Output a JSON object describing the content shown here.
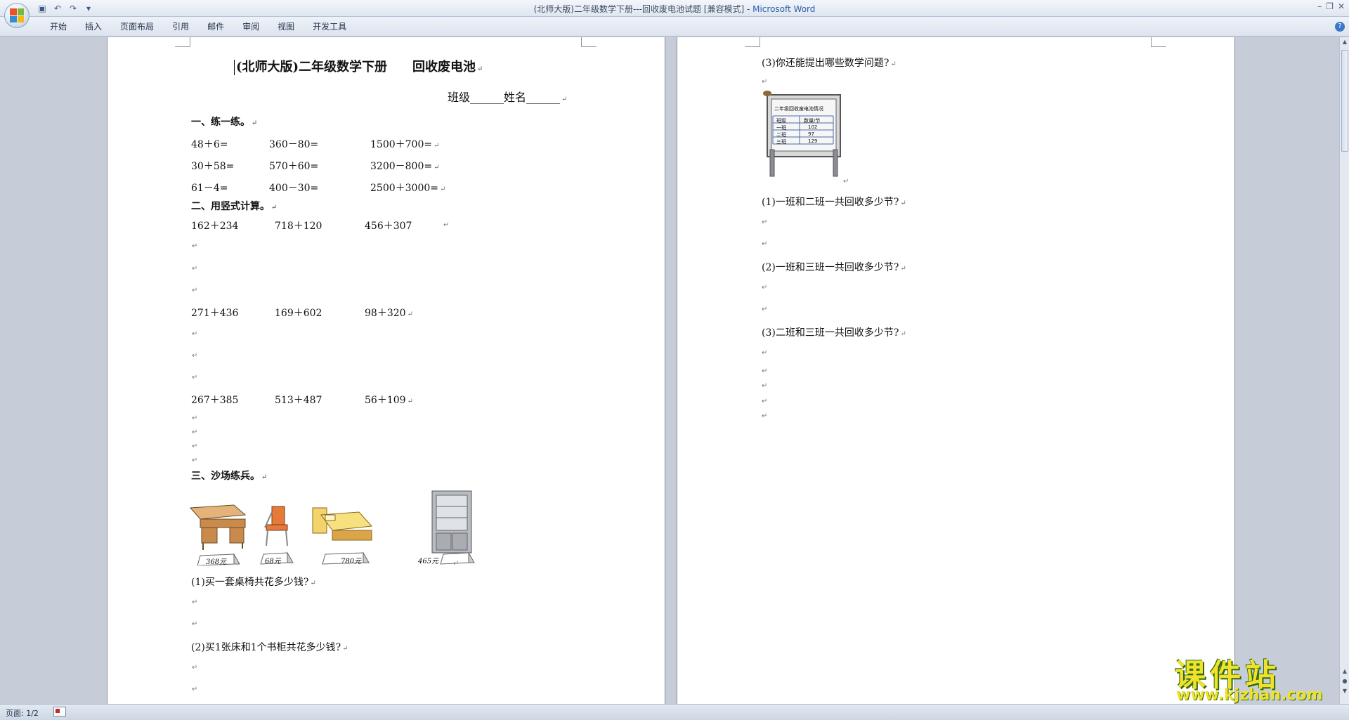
{
  "window": {
    "title_doc": "(北师大版)二年级数学下册---回收废电池试题 [兼容模式] - ",
    "title_app": "Microsoft Word"
  },
  "ribbon": {
    "tabs": [
      "开始",
      "插入",
      "页面布局",
      "引用",
      "邮件",
      "审阅",
      "视图",
      "开发工具"
    ]
  },
  "page1": {
    "title": "(北师大版)二年级数学下册　　回收废电池",
    "class_name": "班级______姓名______",
    "section1": "一、练一练。",
    "practice_rows": [
      [
        "48＋6=",
        "360－80=",
        "1500＋700="
      ],
      [
        "30＋58=",
        "570＋60=",
        "3200－800="
      ],
      [
        "61－4=",
        "400－30=",
        "2500＋3000="
      ]
    ],
    "section2": "二、用竖式计算。",
    "vertical_rows": [
      [
        "162＋234",
        "718＋120",
        "456＋307"
      ],
      [
        "271＋436",
        "169＋602",
        "98＋320"
      ],
      [
        "267＋385",
        "513＋487",
        "56＋109"
      ]
    ],
    "section3": "三、沙场练兵。",
    "prices": [
      "368元",
      "68元",
      "780元",
      "465元"
    ],
    "q1": "(1)买一套桌椅共花多少钱?",
    "q2": "(2)买1张床和1个书柜共花多少钱?"
  },
  "page2": {
    "q3": "(3)你还能提出哪些数学问题?",
    "board": {
      "title": "二年级回收废电池情况",
      "headers": [
        "班级",
        "数量/节"
      ],
      "rows": [
        [
          "一班",
          "102"
        ],
        [
          "二班",
          "97"
        ],
        [
          "三班",
          "129"
        ]
      ]
    },
    "qa": "(1)一班和二班一共回收多少节?",
    "qb": "(2)一班和三班一共回收多少节?",
    "qc": "(3)二班和三班一共回收多少节?"
  },
  "statusbar": {
    "page": "页面: 1/2"
  },
  "watermark": {
    "cn": "课件站",
    "url": "www.kjzhan.com"
  }
}
